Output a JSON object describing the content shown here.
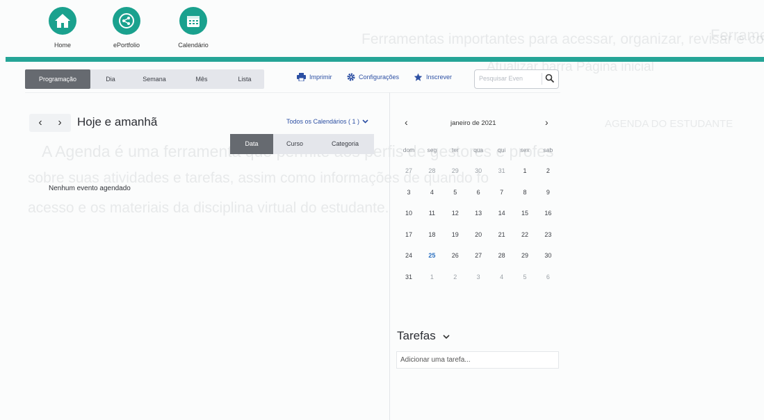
{
  "nav": {
    "items": [
      {
        "label": "Home",
        "icon": "home-icon"
      },
      {
        "label": "ePortfolio",
        "icon": "share-icon"
      },
      {
        "label": "Calendário",
        "icon": "calendar-icon"
      }
    ]
  },
  "toolbar": {
    "tabs": [
      {
        "label": "Programação",
        "active": true
      },
      {
        "label": "Dia",
        "active": false
      },
      {
        "label": "Semana",
        "active": false
      },
      {
        "label": "Mês",
        "active": false
      },
      {
        "label": "Lista",
        "active": false
      }
    ],
    "print_label": "Imprimir",
    "settings_label": "Configurações",
    "subscribe_label": "Inscrever",
    "search_placeholder": "Pesquisar Even"
  },
  "agenda": {
    "title": "Hoje e amanhã",
    "calendar_filter": "Todos os Calendários ( 1 )",
    "sort_tabs": [
      {
        "label": "Data",
        "active": true
      },
      {
        "label": "Curso",
        "active": false
      },
      {
        "label": "Categoria",
        "active": false
      }
    ],
    "empty_message": "Nenhum evento agendado"
  },
  "mini_calendar": {
    "month_title": "janeiro de 2021",
    "weekdays": [
      "dom",
      "seg",
      "ter",
      "qua",
      "qui",
      "sex",
      "sab"
    ],
    "weeks": [
      [
        "27",
        "28",
        "29",
        "30",
        "31",
        "1",
        "2"
      ],
      [
        "3",
        "4",
        "5",
        "6",
        "7",
        "8",
        "9"
      ],
      [
        "10",
        "11",
        "12",
        "13",
        "14",
        "15",
        "16"
      ],
      [
        "17",
        "18",
        "19",
        "20",
        "21",
        "22",
        "23"
      ],
      [
        "24",
        "25",
        "26",
        "27",
        "28",
        "29",
        "30"
      ],
      [
        "31",
        "1",
        "2",
        "3",
        "4",
        "5",
        "6"
      ]
    ],
    "today": "25"
  },
  "tasks": {
    "title": "Tarefas",
    "add_placeholder": "Adicionar uma tarefa..."
  },
  "colors": {
    "accent_teal": "#25a597",
    "link_blue": "#2c4fa3",
    "active_tab": "#666a70"
  }
}
